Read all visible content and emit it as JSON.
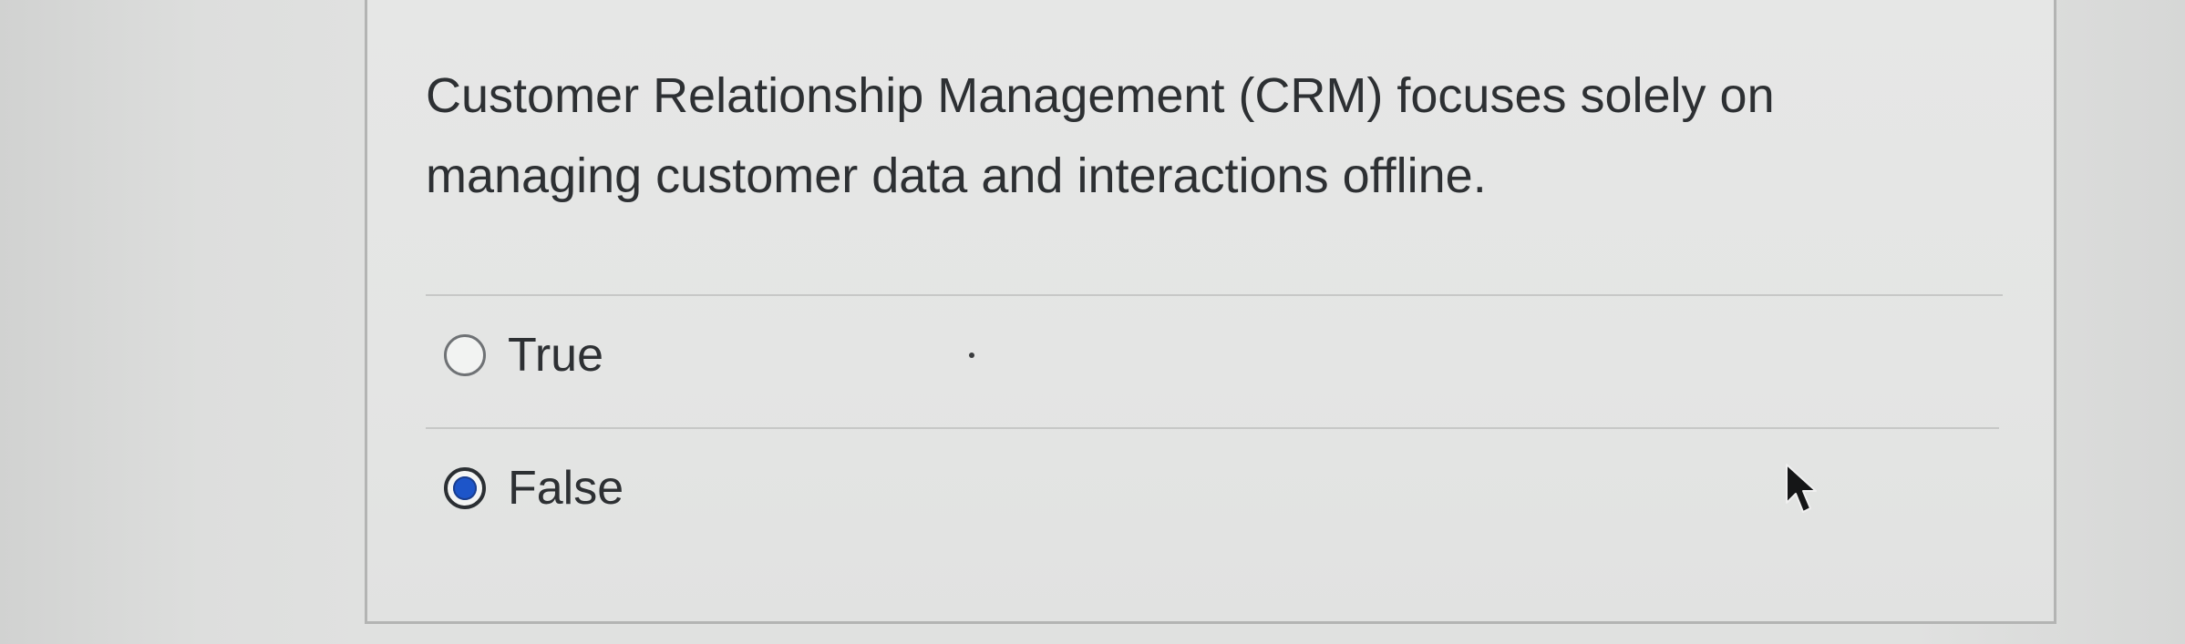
{
  "question": {
    "text": "Customer Relationship Management (CRM) focuses solely on managing customer data and interactions offline.",
    "options": [
      {
        "label": "True",
        "selected": false
      },
      {
        "label": "False",
        "selected": true
      }
    ]
  },
  "colors": {
    "selected_radio_fill": "#1d55c9",
    "text": "#2d3033",
    "card_background": "#e4e5e4",
    "page_background": "#d9dad9"
  },
  "icons": {
    "cursor": "mouse-pointer-arrow-icon"
  }
}
